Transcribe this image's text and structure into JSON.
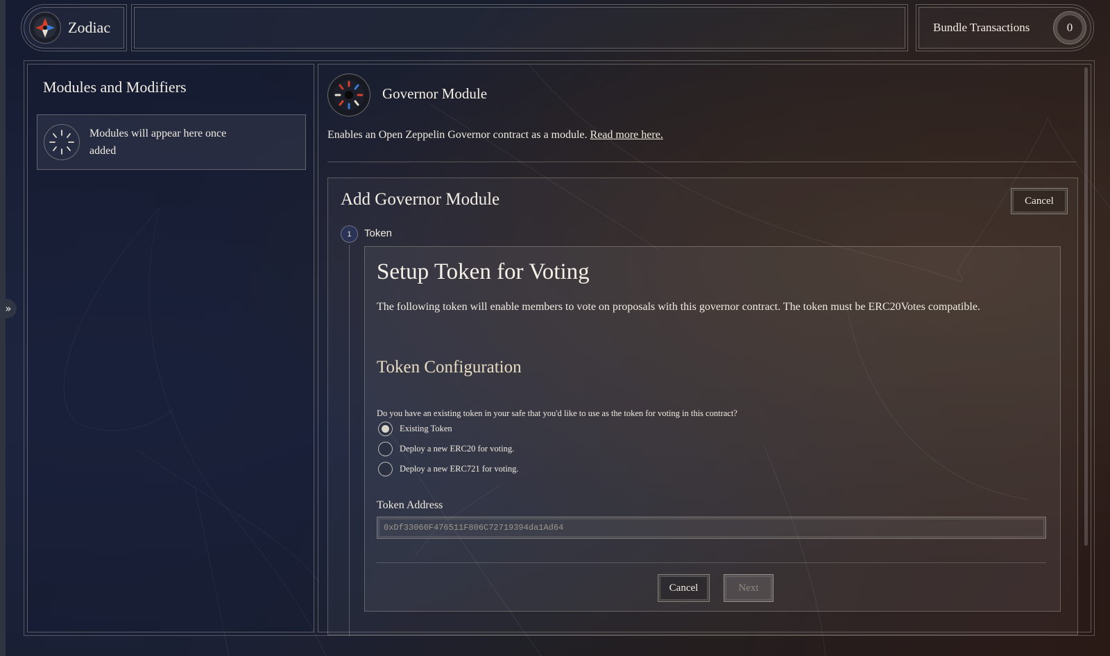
{
  "app": {
    "name": "Zodiac"
  },
  "search": {
    "placeholder": ""
  },
  "bundle": {
    "label": "Bundle Transactions",
    "count": "0"
  },
  "sidebar": {
    "title": "Modules and Modifiers",
    "empty_text": "Modules will appear here once added"
  },
  "module": {
    "title": "Governor Module",
    "description": "Enables an Open Zeppelin Governor contract as a module.",
    "read_more": "Read more here."
  },
  "add_panel": {
    "title": "Add Governor Module",
    "cancel_label": "Cancel",
    "step": {
      "number": "1",
      "label": "Token"
    }
  },
  "token_setup": {
    "title": "Setup Token for Voting",
    "description": "The following token will enable members to vote on proposals with this governor contract. The token must be ERC20Votes compatible.",
    "config_title": "Token Configuration",
    "question": "Do you have an existing token in your safe that you'd like to use as the token for voting in this contract?",
    "options": [
      {
        "label": "Existing Token",
        "checked": true
      },
      {
        "label": "Deploy a new ERC20 for voting.",
        "checked": false
      },
      {
        "label": "Deploy a new ERC721 for voting.",
        "checked": false
      }
    ],
    "address_label": "Token Address",
    "address_value": "0xDf33060F476511F806C72719394da1Ad64",
    "cancel_label": "Cancel",
    "next_label": "Next"
  },
  "colors": {
    "accent_gold": "#e7dcc2",
    "text": "#f1ece2",
    "step_circle": "#2a3356"
  },
  "icons": {
    "expand": "double-chevron-right-icon",
    "brand": "zodiac-logo-icon",
    "module": "governor-module-icon",
    "empty": "loading-spinner-icon"
  }
}
